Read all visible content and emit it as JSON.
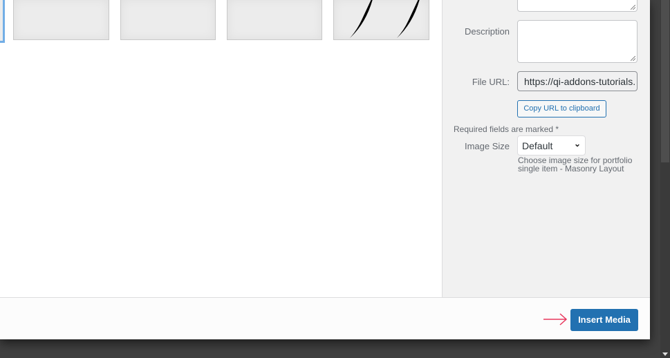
{
  "attachment": {
    "description_label": "Description",
    "file_url_label": "File URL:",
    "file_url_value": "https://qi-addons-tutorials.",
    "copy_url_label": "Copy URL to clipboard",
    "required_note": "Required fields are marked *",
    "image_size_label": "Image Size",
    "image_size_value": "Default",
    "image_size_help": "Choose image size for portfolio single item - Masonry Layout"
  },
  "footer": {
    "insert_label": "Insert Media"
  },
  "colors": {
    "primary": "#2271b1",
    "arrow": "#e8365d",
    "selected": "#72aee6"
  }
}
